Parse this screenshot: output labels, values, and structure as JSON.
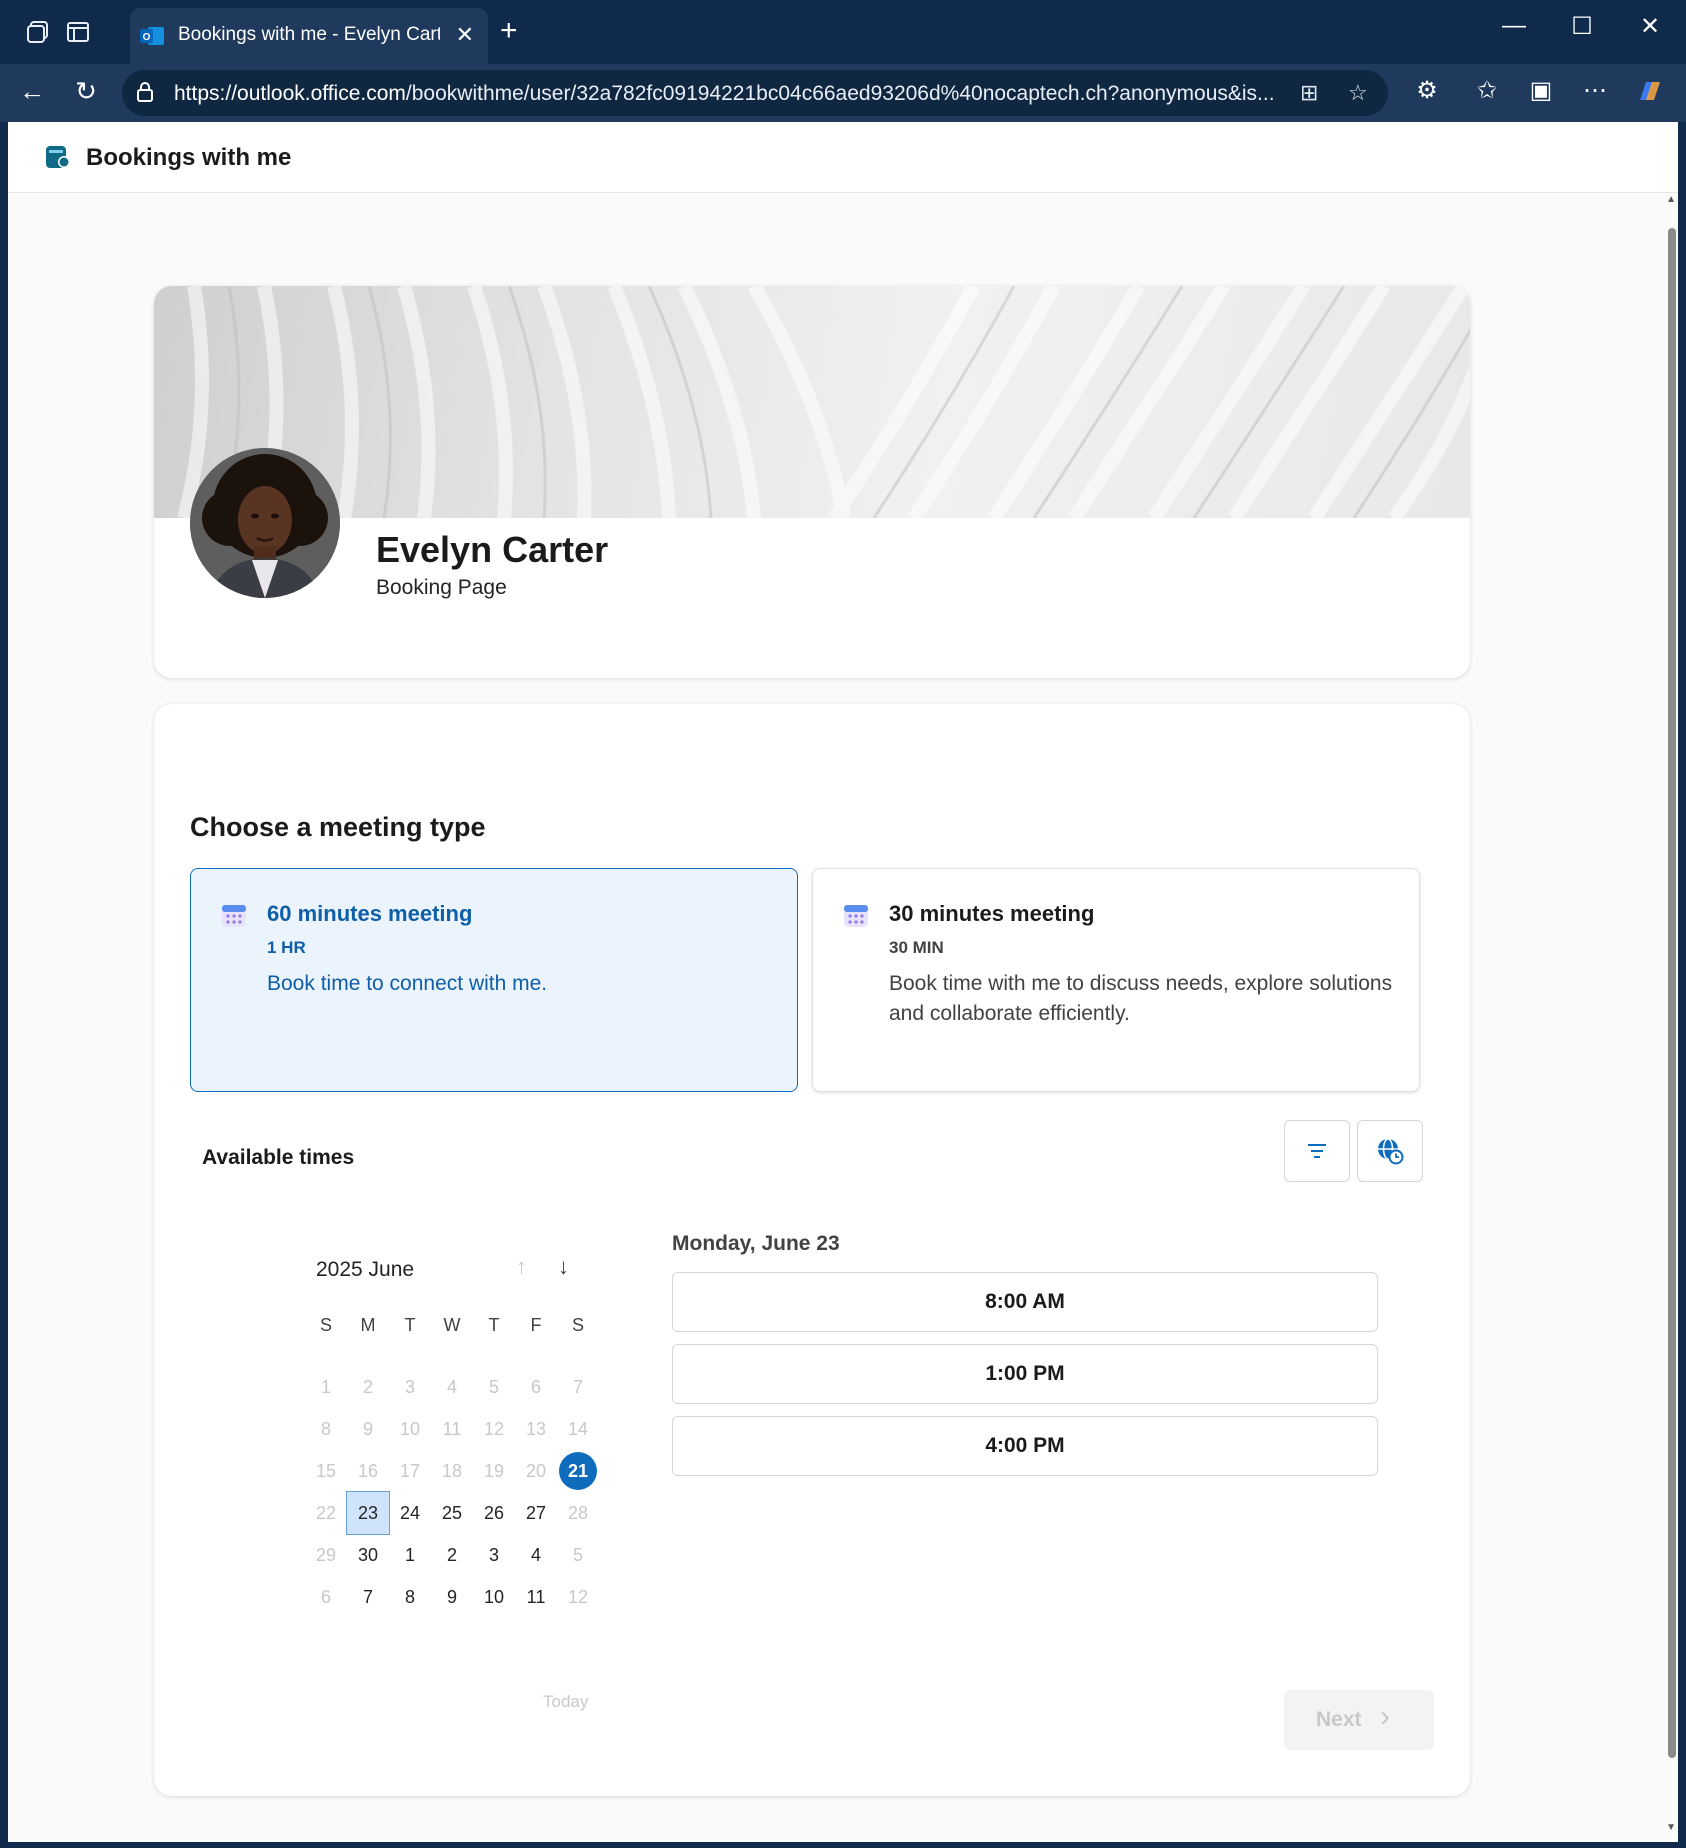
{
  "browser": {
    "tab_title": "Bookings with me - Evelyn Carter",
    "url_host": "https://outlook.office.com",
    "url_path": "/bookwithme/user/32a782fc09194221bc04c66aed93206d%40nocaptech.ch?anonymous&is..."
  },
  "app": {
    "title": "Bookings with me"
  },
  "profile": {
    "name": "Evelyn Carter",
    "subtitle": "Booking Page"
  },
  "meeting_section": {
    "heading": "Choose a meeting type",
    "types": [
      {
        "title": "60 minutes meeting",
        "duration": "1 HR",
        "description": "Book time to connect with me.",
        "selected": true
      },
      {
        "title": "30 minutes meeting",
        "duration": "30 MIN",
        "description": "Book time with me to discuss needs, explore solutions and collaborate efficiently.",
        "selected": false
      }
    ]
  },
  "availability": {
    "heading": "Available times",
    "calendar": {
      "month_label": "2025 June",
      "weekdays": [
        "S",
        "M",
        "T",
        "W",
        "T",
        "F",
        "S"
      ],
      "weeks": [
        [
          "1",
          "2",
          "3",
          "4",
          "5",
          "6",
          "7"
        ],
        [
          "8",
          "9",
          "10",
          "11",
          "12",
          "13",
          "14"
        ],
        [
          "15",
          "16",
          "17",
          "18",
          "19",
          "20",
          "21"
        ],
        [
          "22",
          "23",
          "24",
          "25",
          "26",
          "27",
          "28"
        ],
        [
          "29",
          "30",
          "1",
          "2",
          "3",
          "4",
          "5"
        ],
        [
          "6",
          "7",
          "8",
          "9",
          "10",
          "11",
          "12"
        ]
      ],
      "today_label": "Today"
    },
    "selected_date_label": "Monday, June 23",
    "slots": [
      "8:00 AM",
      "1:00 PM",
      "4:00 PM"
    ],
    "next_label": "Next"
  },
  "colors": {
    "accent": "#0f6cbd",
    "selected_bg": "#ebf3fc",
    "window_frame": "#0f2a4a"
  }
}
